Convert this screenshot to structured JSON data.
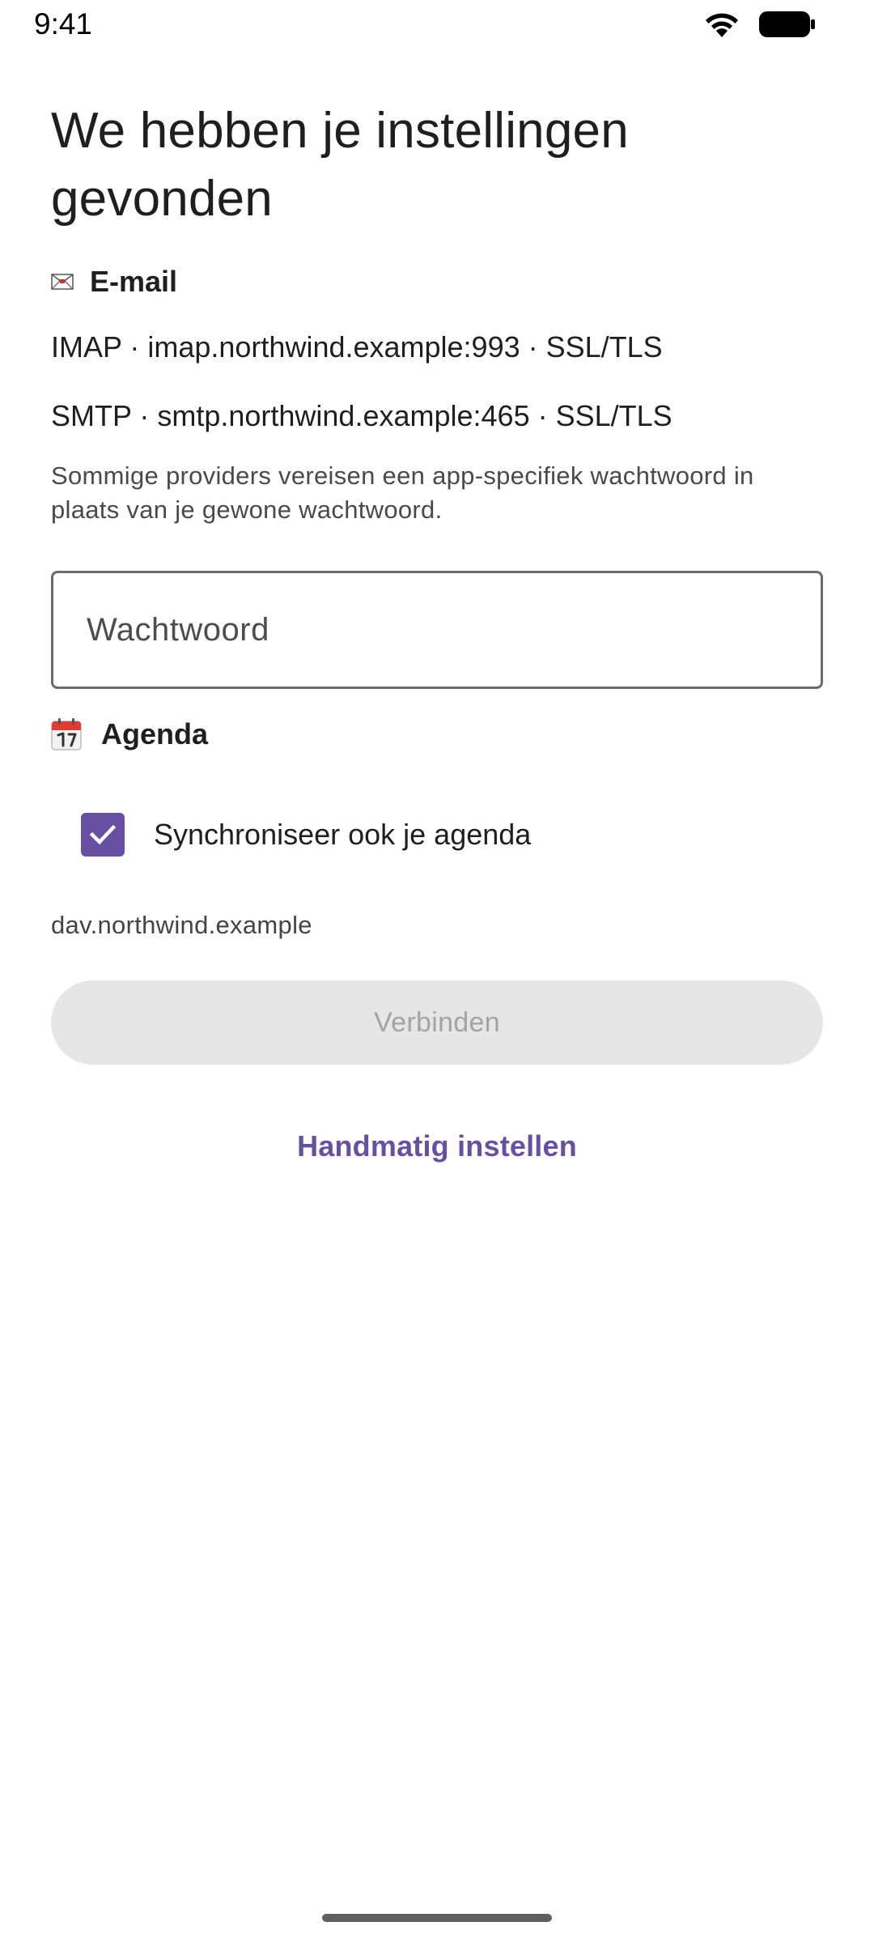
{
  "status_bar": {
    "time": "9:41",
    "icons": [
      "wifi-icon",
      "battery-icon"
    ]
  },
  "page": {
    "title": "We hebben je instellingen gevonden"
  },
  "email_section": {
    "icon": "envelope-icon",
    "label": "E-mail",
    "imap": "IMAP · imap.northwind.example:993 · SSL/TLS",
    "smtp": "SMTP · smtp.northwind.example:465 · SSL/TLS",
    "hint": "Sommige providers vereisen een app-specifiek wachtwoord in plaats van je gewone wachtwoord.",
    "password": {
      "placeholder": "Wachtwoord",
      "value": ""
    }
  },
  "calendar_section": {
    "icon": "calendar-icon",
    "label": "Agenda",
    "sync_checkbox": {
      "label": "Synchroniseer ook je agenda",
      "checked": true
    },
    "server": "dav.northwind.example"
  },
  "actions": {
    "connect_label": "Verbinden",
    "connect_enabled": false,
    "manual_setup_label": "Handmatig instellen"
  },
  "colors": {
    "accent": "#6750a4",
    "button_disabled_bg": "#e6e6e6",
    "button_disabled_text": "#a3a3a3",
    "field_border": "#6b6b6b"
  }
}
